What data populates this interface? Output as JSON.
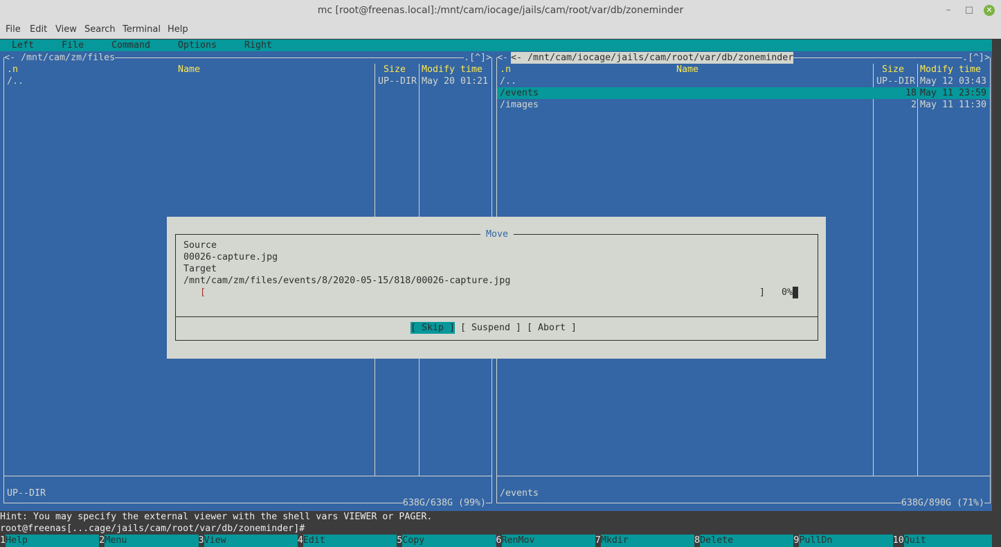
{
  "window": {
    "title": "mc [root@freenas.local]:/mnt/cam/iocage/jails/cam/root/var/db/zoneminder",
    "minimize": "–",
    "maximize": "□",
    "close": "✕"
  },
  "app_menu": [
    "File",
    "Edit",
    "View",
    "Search",
    "Terminal",
    "Help"
  ],
  "mc_menu": [
    "Left",
    "File",
    "Command",
    "Options",
    "Right"
  ],
  "left_panel": {
    "path": "<- /mnt/cam/zm/files",
    "corner": ".[^]>",
    "cols": {
      "n": ".n",
      "name": "Name",
      "size": "Size",
      "mtime": "Modify time"
    },
    "rows": [
      {
        "name": "/..",
        "size": "UP--DIR",
        "mtime": "May 20 01:21"
      }
    ],
    "status": "UP--DIR",
    "free": "638G/638G (99%)"
  },
  "right_panel": {
    "path": "<- /mnt/cam/iocage/jails/cam/root/var/db/zoneminder",
    "corner": ".[^]>",
    "cols": {
      "n": ".n",
      "name": "Name",
      "size": "Size",
      "mtime": "Modify time"
    },
    "rows": [
      {
        "name": "/..",
        "size": "UP--DIR",
        "mtime": "May 12 03:43"
      },
      {
        "name": "/events",
        "size": "18",
        "mtime": "May 11 23:59",
        "selected": true
      },
      {
        "name": "/images",
        "size": "2",
        "mtime": "May 11 11:30"
      }
    ],
    "status": "/events",
    "free": "638G/890G (71%)"
  },
  "dialog": {
    "title": "Move",
    "source_label": "Source",
    "source": "00026-capture.jpg",
    "target_label": "Target",
    "target": "/mnt/cam/zm/files/events/8/2020-05-15/818/00026-capture.jpg",
    "progress_open": "[",
    "progress_close": "]",
    "progress_text": "0%",
    "progress": 0,
    "buttons": {
      "skip": "[ Skip ]",
      "suspend": "[ Suspend ]",
      "abort": "[ Abort ]"
    }
  },
  "hint": "Hint: You may specify the external viewer with the shell vars VIEWER or PAGER.",
  "prompt": "root@freenas[...cage/jails/cam/root/var/db/zoneminder]#",
  "fkeys": [
    {
      "n": "1",
      "l": "Help"
    },
    {
      "n": "2",
      "l": "Menu"
    },
    {
      "n": "3",
      "l": "View"
    },
    {
      "n": "4",
      "l": "Edit"
    },
    {
      "n": "5",
      "l": "Copy"
    },
    {
      "n": "6",
      "l": "RenMov"
    },
    {
      "n": "7",
      "l": "Mkdir"
    },
    {
      "n": "8",
      "l": "Delete"
    },
    {
      "n": "9",
      "l": "PullDn"
    },
    {
      "n": "10",
      "l": "Quit"
    }
  ]
}
